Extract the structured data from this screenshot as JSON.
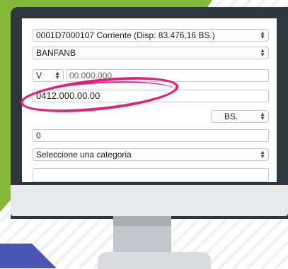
{
  "form": {
    "account_select": "0001D7000107 Corriente (Disp: 83.476,16 BS.)",
    "bank_select": "BANFANB",
    "id_type_select": "V",
    "id_number": "00.000.000",
    "phone_number": "0412.000.00.00",
    "currency_select": "BS.",
    "amount": "0",
    "category_select": "Seleccione una categoria"
  },
  "colors": {
    "accent_green": "#86b83a",
    "highlight_pink": "#e0207a",
    "monitor_dark": "#2e3640",
    "blue_accent": "#4a55b5"
  },
  "icons": {
    "select_arrows": "up-down-chevron-icon"
  }
}
